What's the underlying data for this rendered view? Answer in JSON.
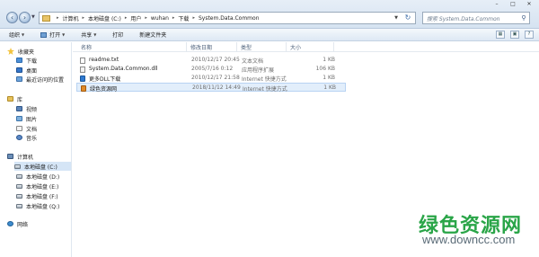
{
  "address_bar": {
    "breadcrumbs": [
      "计算机",
      "本地磁盘 (C:)",
      "用户",
      "wuhan",
      "下载",
      "System.Data.Common"
    ]
  },
  "search": {
    "placeholder": "搜索 System.Data.Common"
  },
  "toolbar": {
    "organize": "组织",
    "open": "打开",
    "share": "共享",
    "print": "打印",
    "new_folder": "新建文件夹"
  },
  "nav": {
    "favorites": "收藏夹",
    "downloads": "下载",
    "desktop": "桌面",
    "recent": "最近访问的位置",
    "libraries": "库",
    "videos": "视频",
    "pictures": "图片",
    "documents": "文档",
    "music": "音乐",
    "computer": "计算机",
    "drives": [
      "本地磁盘 (C:)",
      "本地磁盘 (D:)",
      "本地磁盘 (E:)",
      "本地磁盘 (F:)",
      "本地磁盘 (Q:)"
    ],
    "network": "网络"
  },
  "columns": {
    "name": "名称",
    "date": "修改日期",
    "type": "类型",
    "size": "大小"
  },
  "files": [
    {
      "name": "readme.txt",
      "date": "2010/12/17 20:45",
      "type": "文本文档",
      "size": "1 KB",
      "icon": "text-file-icon"
    },
    {
      "name": "System.Data.Common.dll",
      "date": "2005/7/16 0:12",
      "type": "应用程序扩展",
      "size": "106 KB",
      "icon": "dll-file-icon"
    },
    {
      "name": "更多DLL下载",
      "date": "2010/12/17 21:58",
      "type": "Internet 快捷方式",
      "size": "1 KB",
      "icon": "internet-shortcut-icon"
    },
    {
      "name": "绿色资源网",
      "date": "2018/11/12 14:49",
      "type": "Internet 快捷方式",
      "size": "1 KB",
      "icon": "internet-shortcut-icon"
    }
  ],
  "watermark": {
    "logo": "绿色资源网",
    "url": "www.downcc.com"
  }
}
